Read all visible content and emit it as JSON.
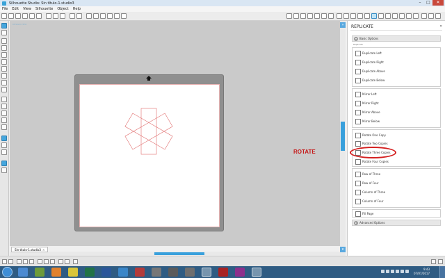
{
  "window": {
    "title": "Silhouette Studio: Sin título-1.studio3",
    "minimize": "–",
    "maximize": "□",
    "close": "✕"
  },
  "menu": [
    "File",
    "Edit",
    "View",
    "Silhouette",
    "Object",
    "Help"
  ],
  "canvas": {
    "tab_hint": "DESIGN VIEW",
    "doc_tab": "Sin título-1.studio3",
    "doc_tab_close": "×"
  },
  "annotation": {
    "label": "ROTATE",
    "color": "#c51a1a"
  },
  "panel": {
    "title": "REPLICATE",
    "close": "»",
    "basic_options": "Basic Options",
    "sublabel": "Replicate",
    "duplicate": [
      "Duplicate Left",
      "Duplicate Right",
      "Duplicate Above",
      "Duplicate Below"
    ],
    "mirror": [
      "Mirror Left",
      "Mirror Right",
      "Mirror Above",
      "Mirror Below"
    ],
    "rotate": [
      "Rotate One Copy",
      "Rotate Two Copies",
      "Rotate Three Copies",
      "Rotate Four Copies"
    ],
    "rows": [
      "Row of Three",
      "Row of Four",
      "Column of Three",
      "Column of Four"
    ],
    "fill": [
      "Fill Page"
    ],
    "advanced": "Advanced Options",
    "chevron_open": "▾",
    "chevron_closed": "▸"
  },
  "taskbar": {
    "time": "9:43",
    "date": "07/07/2017"
  },
  "colors": {
    "accent": "#39a0dc",
    "cut_line": "#e06a6a",
    "highlight": "#d42121"
  }
}
